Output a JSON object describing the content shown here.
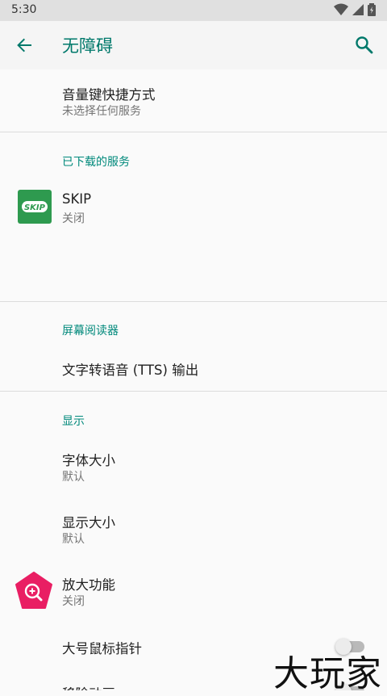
{
  "status": {
    "time": "5:30"
  },
  "app_bar": {
    "title": "无障碍"
  },
  "items": {
    "volume_shortcut": {
      "title": "音量键快捷方式",
      "subtitle": "未选择任何服务"
    },
    "downloaded_header": "已下载的服务",
    "skip": {
      "title": "SKIP",
      "subtitle": "关闭",
      "icon_text": "SKIP"
    },
    "screen_reader_header": "屏幕阅读器",
    "tts": {
      "title": "文字转语音 (TTS) 输出"
    },
    "display_header": "显示",
    "font_size": {
      "title": "字体大小",
      "subtitle": "默认"
    },
    "display_size": {
      "title": "显示大小",
      "subtitle": "默认"
    },
    "magnification": {
      "title": "放大功能",
      "subtitle": "关闭"
    },
    "large_pointer": {
      "title": "大号鼠标指针"
    },
    "remove_animation": {
      "title": "移除动画"
    }
  },
  "watermark": "大玩家",
  "colors": {
    "accent": "#00796b",
    "skip_green": "#2e9a4f",
    "magnify_pink": "#e91e63"
  }
}
